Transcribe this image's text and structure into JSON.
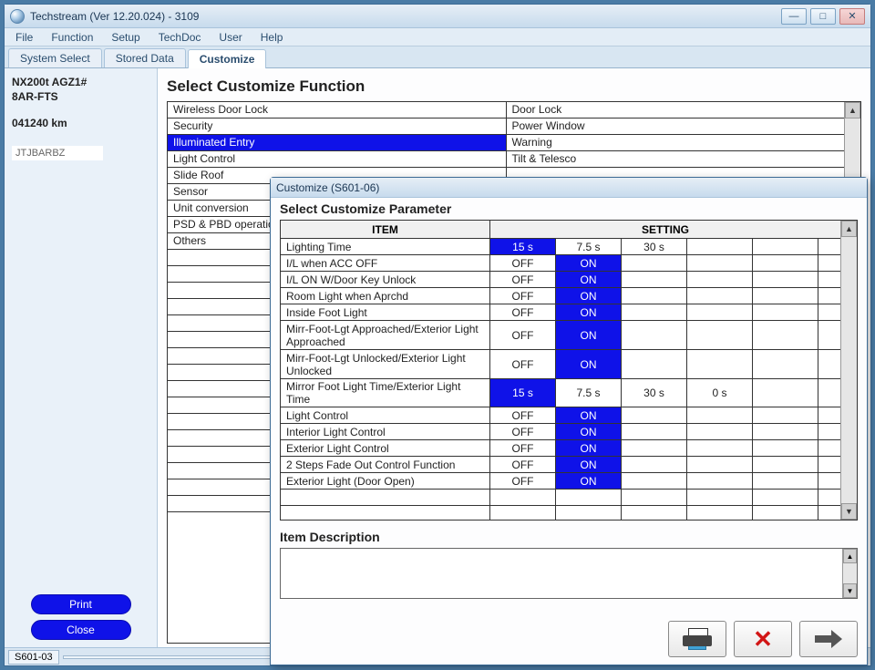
{
  "window": {
    "title": "Techstream (Ver 12.20.024) - 3109"
  },
  "menu": [
    "File",
    "Function",
    "Setup",
    "TechDoc",
    "User",
    "Help"
  ],
  "tabs": {
    "items": [
      "System Select",
      "Stored Data",
      "Customize"
    ],
    "active_index": 2
  },
  "vehicle": {
    "line1": "NX200t AGZ1#",
    "line2": "8AR-FTS",
    "odo": "041240 km",
    "vin": "JTJBARBZ"
  },
  "side_buttons": {
    "print": "Print",
    "close": "Close"
  },
  "statusbar": {
    "code": "S601-03"
  },
  "main": {
    "heading": "Select Customize Function",
    "rows": [
      {
        "l": "Wireless Door Lock",
        "r": "Door Lock"
      },
      {
        "l": "Security",
        "r": "Power Window"
      },
      {
        "l": "Illuminated Entry",
        "r": "Warning",
        "l_sel": true
      },
      {
        "l": "Light Control",
        "r": "Tilt & Telesco"
      },
      {
        "l": "Slide Roof",
        "r": ""
      },
      {
        "l": "Sensor",
        "r": ""
      },
      {
        "l": "Unit conversion",
        "r": ""
      },
      {
        "l": "PSD & PBD operation",
        "r": ""
      },
      {
        "l": "Others",
        "r": ""
      }
    ],
    "blank_rows": 16
  },
  "popup": {
    "title": "Customize (S601-06)",
    "heading": "Select Customize Parameter",
    "headers": {
      "item": "ITEM",
      "setting": "SETTING"
    },
    "params": [
      {
        "item": "Lighting Time",
        "opts": [
          "15 s",
          "7.5 s",
          "30 s",
          "",
          ""
        ],
        "sel": 0
      },
      {
        "item": "I/L when ACC OFF",
        "opts": [
          "OFF",
          "ON",
          "",
          "",
          ""
        ],
        "sel": 1
      },
      {
        "item": "I/L ON W/Door Key Unlock",
        "opts": [
          "OFF",
          "ON",
          "",
          "",
          ""
        ],
        "sel": 1
      },
      {
        "item": "Room Light when Aprchd",
        "opts": [
          "OFF",
          "ON",
          "",
          "",
          ""
        ],
        "sel": 1
      },
      {
        "item": "Inside Foot Light",
        "opts": [
          "OFF",
          "ON",
          "",
          "",
          ""
        ],
        "sel": 1
      },
      {
        "item": "Mirr-Foot-Lgt Approached/Exterior Light Approached",
        "opts": [
          "OFF",
          "ON",
          "",
          "",
          ""
        ],
        "sel": 1,
        "tall": true
      },
      {
        "item": "Mirr-Foot-Lgt Unlocked/Exterior Light Unlocked",
        "opts": [
          "OFF",
          "ON",
          "",
          "",
          ""
        ],
        "sel": 1,
        "tall": true
      },
      {
        "item": "Mirror Foot Light Time/Exterior Light Time",
        "opts": [
          "15 s",
          "7.5 s",
          "30 s",
          "0 s",
          ""
        ],
        "sel": 0
      },
      {
        "item": "Light Control",
        "opts": [
          "OFF",
          "ON",
          "",
          "",
          ""
        ],
        "sel": 1
      },
      {
        "item": "Interior Light Control",
        "opts": [
          "OFF",
          "ON",
          "",
          "",
          ""
        ],
        "sel": 1
      },
      {
        "item": "Exterior Light Control",
        "opts": [
          "OFF",
          "ON",
          "",
          "",
          ""
        ],
        "sel": 1
      },
      {
        "item": "2 Steps Fade Out Control Function",
        "opts": [
          "OFF",
          "ON",
          "",
          "",
          ""
        ],
        "sel": 1
      },
      {
        "item": "Exterior Light (Door Open)",
        "opts": [
          "OFF",
          "ON",
          "",
          "",
          ""
        ],
        "sel": 1
      }
    ],
    "blank_param_rows": 2,
    "desc_label": "Item Description"
  }
}
